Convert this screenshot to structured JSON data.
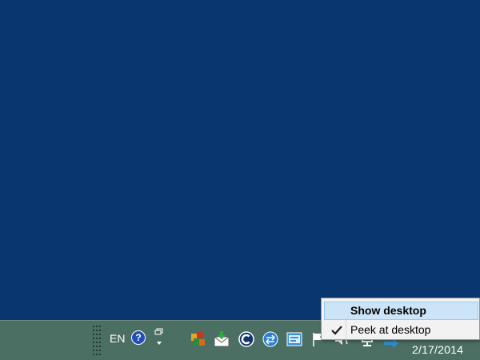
{
  "colors": {
    "desktop_bg": "#0a3670",
    "taskbar_bg": "#4c6f64",
    "menu_bg": "#f2f2f2",
    "menu_highlight": "#cce4f7"
  },
  "taskbar": {
    "language": "EN",
    "help_glyph": "?",
    "tray_icons": [
      "orange-app-icon",
      "mail-download-icon",
      "c-circle-app-icon",
      "sync-circle-icon",
      "network-window-icon",
      "action-center-flag-icon",
      "volume-icon",
      "network-monitor-icon",
      "arrow-icon"
    ],
    "clock_date": "2/17/2014"
  },
  "context_menu": {
    "items": [
      {
        "label": "Show desktop",
        "highlighted": true,
        "checked": false
      },
      {
        "label": "Peek at desktop",
        "highlighted": false,
        "checked": true
      }
    ]
  }
}
